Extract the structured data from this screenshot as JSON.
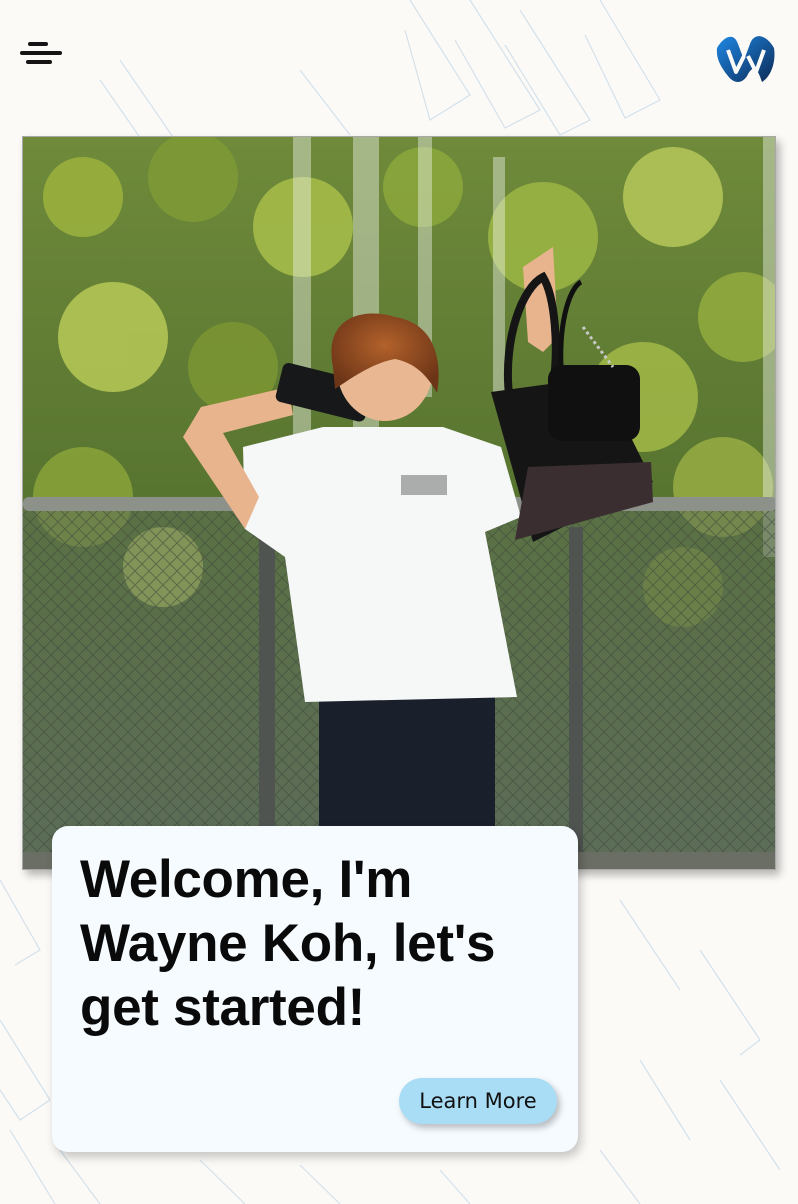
{
  "header": {
    "menu_icon": "hamburger-menu-icon",
    "logo_icon": "w-logo-icon"
  },
  "hero": {
    "photo": "portrait-photo"
  },
  "welcome_card": {
    "headline": "Welcome, I'm Wayne Koh, let's get started!",
    "button_label": "Learn More"
  },
  "colors": {
    "page_background": "#fcfaf7",
    "card_background": "#f5fbff",
    "button_background": "#a9dcf5",
    "logo_blue": "#1565c0",
    "logo_dark": "#0d2a55",
    "text": "#0a0a0a"
  }
}
